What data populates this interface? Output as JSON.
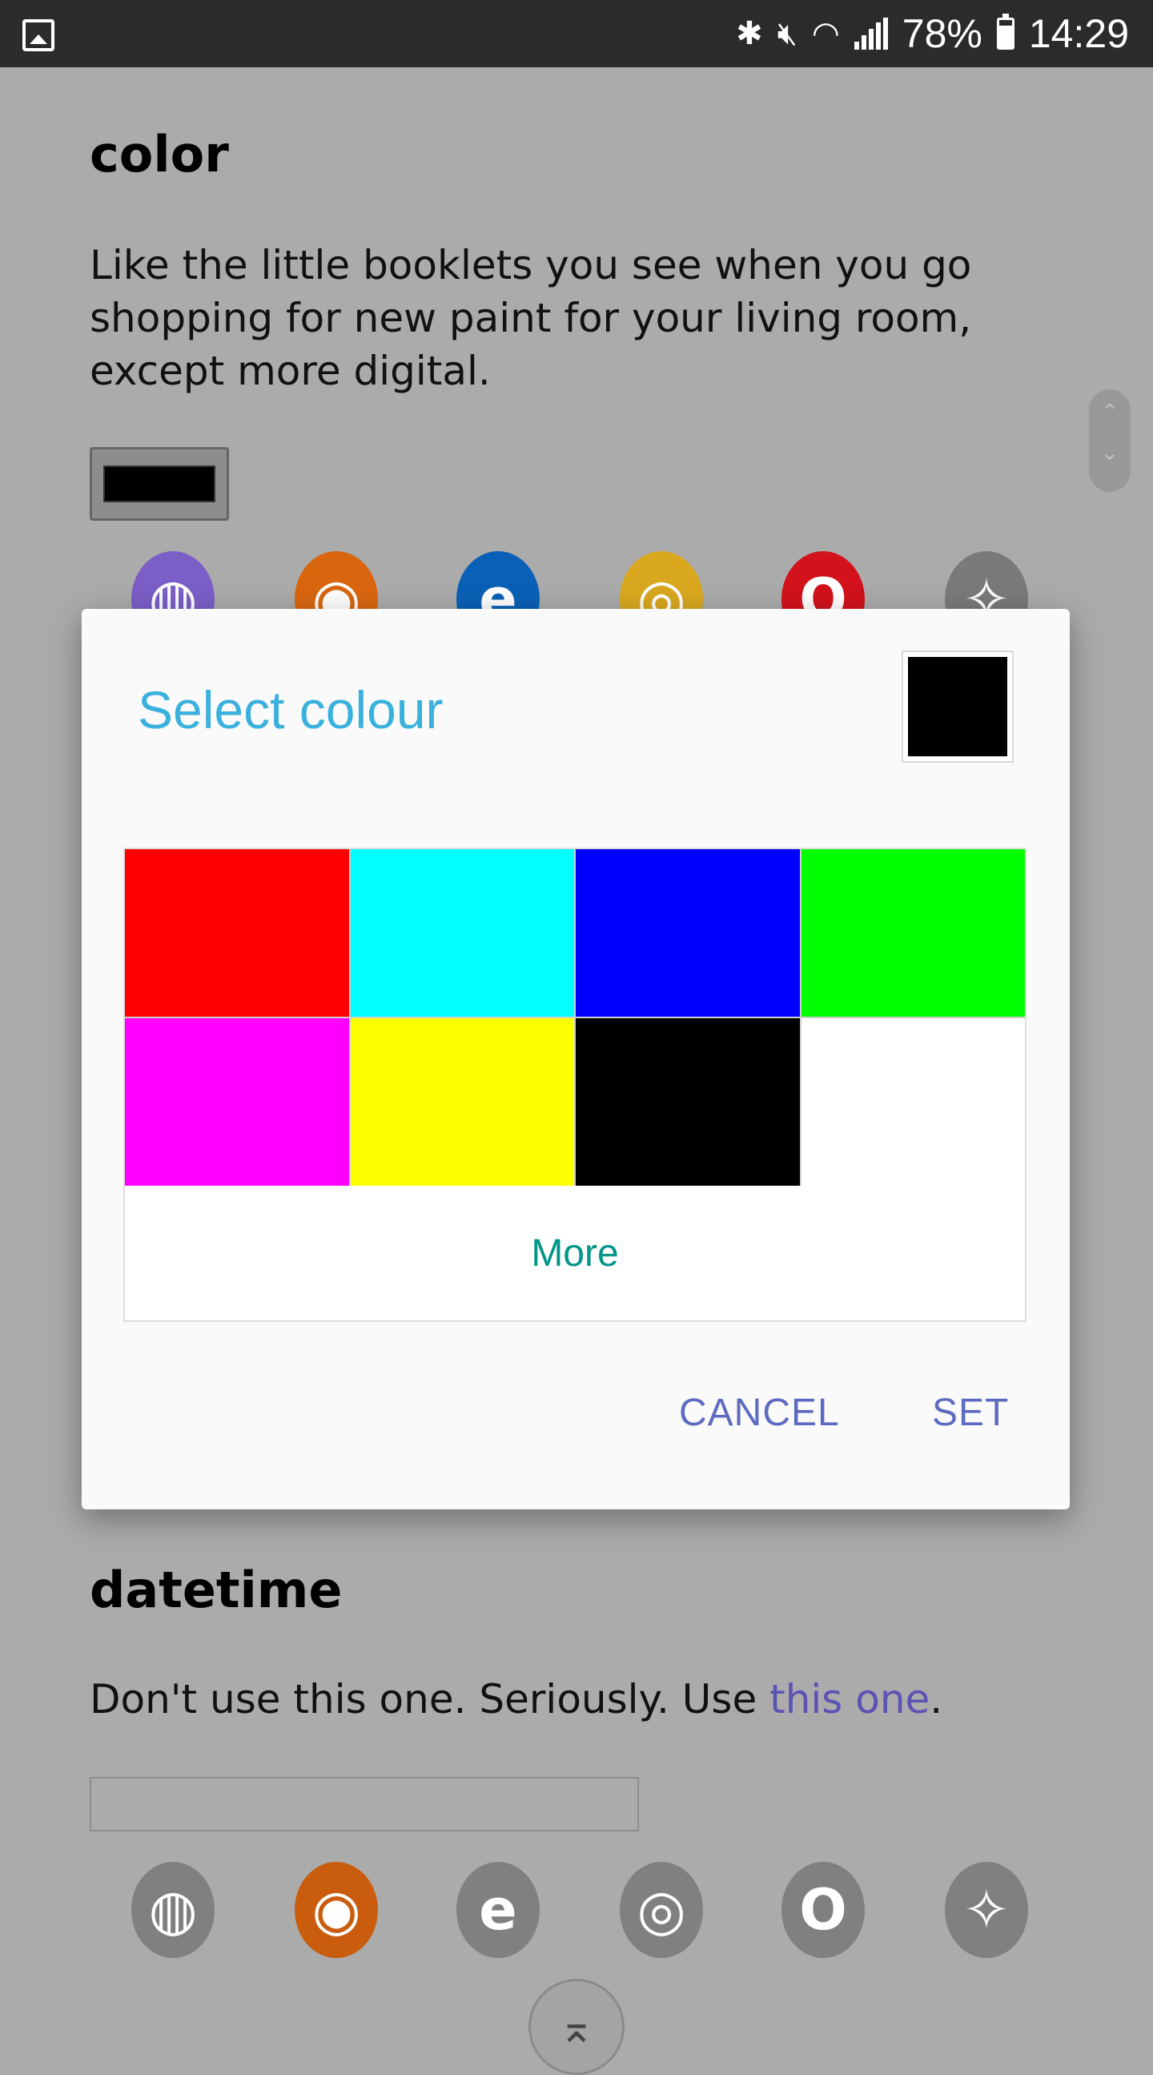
{
  "status_bar": {
    "battery": "78%",
    "time": "14:29",
    "icons": [
      "gallery-icon",
      "bluetooth-icon",
      "mute-icon",
      "wifi-icon",
      "signal-icon",
      "battery-icon"
    ]
  },
  "page": {
    "color_section": {
      "heading": "color",
      "description": "Like the little booklets you see when you go shopping for new paint for your living room, except more digital.",
      "value": "#000000"
    },
    "datetime_section": {
      "heading": "datetime",
      "desc_prefix": "Don't use this one. Seriously. Use ",
      "desc_link": "this one",
      "desc_suffix": "."
    },
    "browser_icons": [
      "samsung-internet-icon",
      "firefox-icon",
      "edge-icon",
      "chrome-icon",
      "opera-icon",
      "safari-icon"
    ]
  },
  "dialog": {
    "title": "Select colour",
    "selected_color": "#000000",
    "swatches": [
      "#ff0000",
      "#00ffff",
      "#0000ff",
      "#00ff00",
      "#ff00ff",
      "#ffff00",
      "#000000",
      "#ffffff"
    ],
    "more_label": "More",
    "cancel_label": "CANCEL",
    "set_label": "SET"
  }
}
